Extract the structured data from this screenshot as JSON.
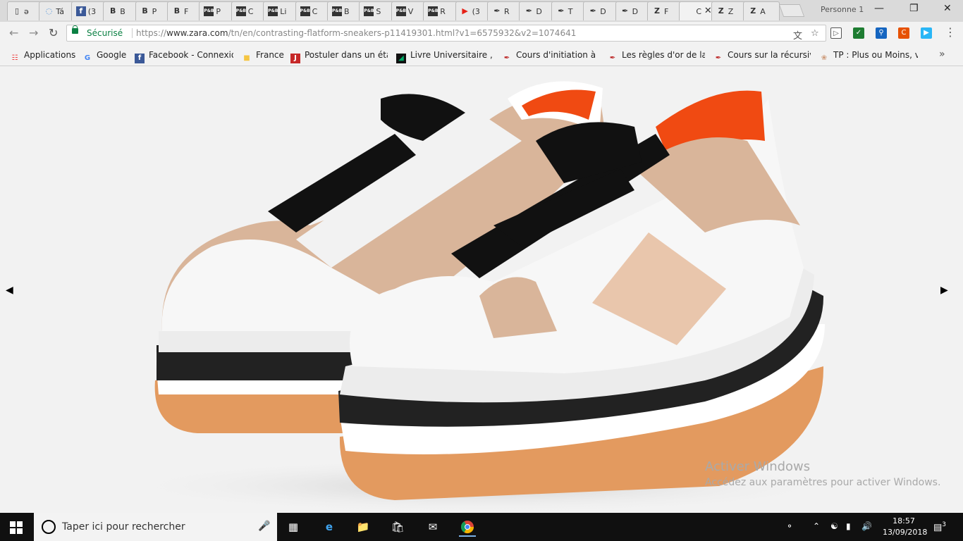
{
  "browser": {
    "tabs": [
      {
        "icon": "page-icon",
        "label": "ə"
      },
      {
        "icon": "loading-icon",
        "label": "Tá"
      },
      {
        "icon": "facebook-icon",
        "label": "(3"
      },
      {
        "icon": "b-icon",
        "label": "B"
      },
      {
        "icon": "b-icon",
        "label": "P"
      },
      {
        "icon": "b-icon",
        "label": "F"
      },
      {
        "icon": "pb-icon",
        "label": "P"
      },
      {
        "icon": "pb-icon",
        "label": "C"
      },
      {
        "icon": "pb-icon",
        "label": "Li"
      },
      {
        "icon": "pb-icon",
        "label": "C"
      },
      {
        "icon": "pb-icon",
        "label": "B"
      },
      {
        "icon": "pb-icon",
        "label": "S"
      },
      {
        "icon": "pb-icon",
        "label": "V"
      },
      {
        "icon": "pb-icon",
        "label": "R"
      },
      {
        "icon": "youtube-icon",
        "label": "(3"
      },
      {
        "icon": "quill-icon",
        "label": "R"
      },
      {
        "icon": "quill-icon",
        "label": "D"
      },
      {
        "icon": "quill-icon",
        "label": "T"
      },
      {
        "icon": "quill-icon",
        "label": "D"
      },
      {
        "icon": "quill-icon",
        "label": "D"
      },
      {
        "icon": "zara-icon",
        "label": "F"
      },
      {
        "icon": "blank-icon",
        "label": "C",
        "active": true
      },
      {
        "icon": "zara-icon",
        "label": "Z"
      },
      {
        "icon": "zara-icon",
        "label": "A"
      }
    ],
    "profile": "Personne 1",
    "secure_label": "Sécurisé",
    "url_prefix": "https://",
    "url_host": "www.zara.com",
    "url_path": "/tn/en/contrasting-flatform-sneakers-p11419301.html?v1=6575932&v2=1074641",
    "bookmarks": [
      {
        "icon": "apps-icon",
        "label": "Applications"
      },
      {
        "icon": "google-icon",
        "label": "Google"
      },
      {
        "icon": "facebook-icon",
        "label": "Facebook - Connexio"
      },
      {
        "icon": "folder-icon",
        "label": "France"
      },
      {
        "icon": "j-icon",
        "label": "Postuler dans un étab"
      },
      {
        "icon": "book-icon",
        "label": "Livre Universitaire , co"
      },
      {
        "icon": "quill-icon",
        "label": "Cours d'initiation à l'a"
      },
      {
        "icon": "quill-icon",
        "label": "Les règles d'or de la p"
      },
      {
        "icon": "quill-icon",
        "label": "Cours sur la récursivit"
      },
      {
        "icon": "openclassrooms-icon",
        "label": "TP : Plus ou Moins, vo"
      }
    ],
    "bookmarks_more": "»"
  },
  "content": {
    "prev_arrow": "◀",
    "next_arrow": "▶",
    "watermark_title": "Activer Windows",
    "watermark_sub": "Accédez aux paramètres pour activer Windows."
  },
  "taskbar": {
    "search_placeholder": "Taper ici pour rechercher",
    "time": "18:57",
    "date": "13/09/2018",
    "notifications": "3"
  },
  "colors": {
    "accent_secure": "#0b8043",
    "taskbar_bg": "#101010",
    "content_bg": "#f2f2f2"
  }
}
